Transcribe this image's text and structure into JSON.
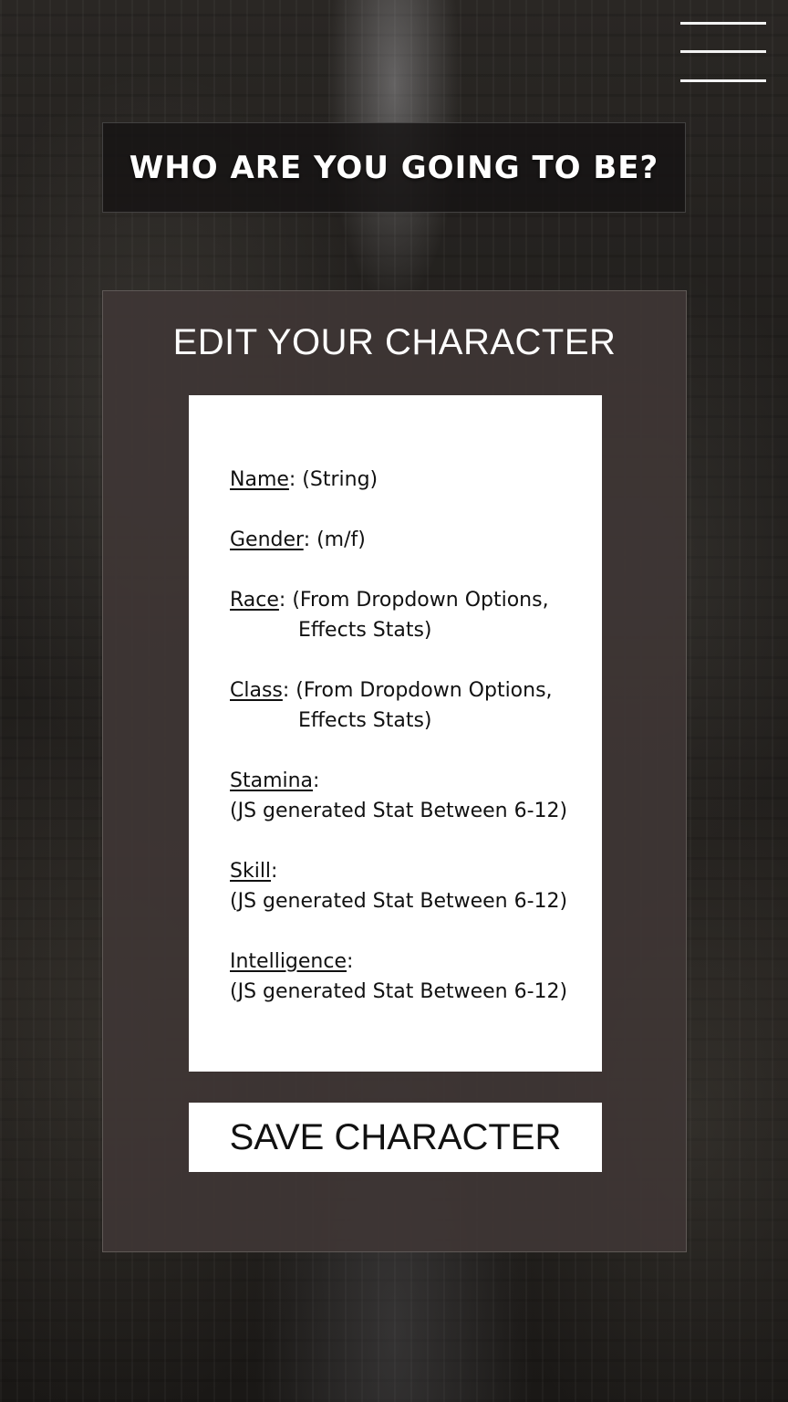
{
  "menu": {
    "icon": "hamburger-menu-icon"
  },
  "header": {
    "title": "WHO ARE YOU GOING TO BE?"
  },
  "editor": {
    "heading": "EDIT YOUR CHARACTER",
    "fields": {
      "name": {
        "label": "Name",
        "value": ": (String)"
      },
      "gender": {
        "label": "Gender",
        "value": ": (m/f)"
      },
      "race": {
        "label": "Race",
        "value": ": (From Dropdown Options,",
        "value_cont": "Effects Stats)"
      },
      "class": {
        "label": "Class",
        "value": ": (From Dropdown Options,",
        "value_cont": "Effects Stats)"
      },
      "stamina": {
        "label": "Stamina",
        "suffix": ":",
        "value": "(JS generated Stat Between 6-12)"
      },
      "skill": {
        "label": "Skill",
        "suffix": ":",
        "value": "(JS generated Stat Between 6-12)"
      },
      "intelligence": {
        "label": "Intelligence",
        "suffix": ":",
        "value": "(JS generated Stat Between 6-12)"
      }
    },
    "save_label": "SAVE CHARACTER"
  }
}
